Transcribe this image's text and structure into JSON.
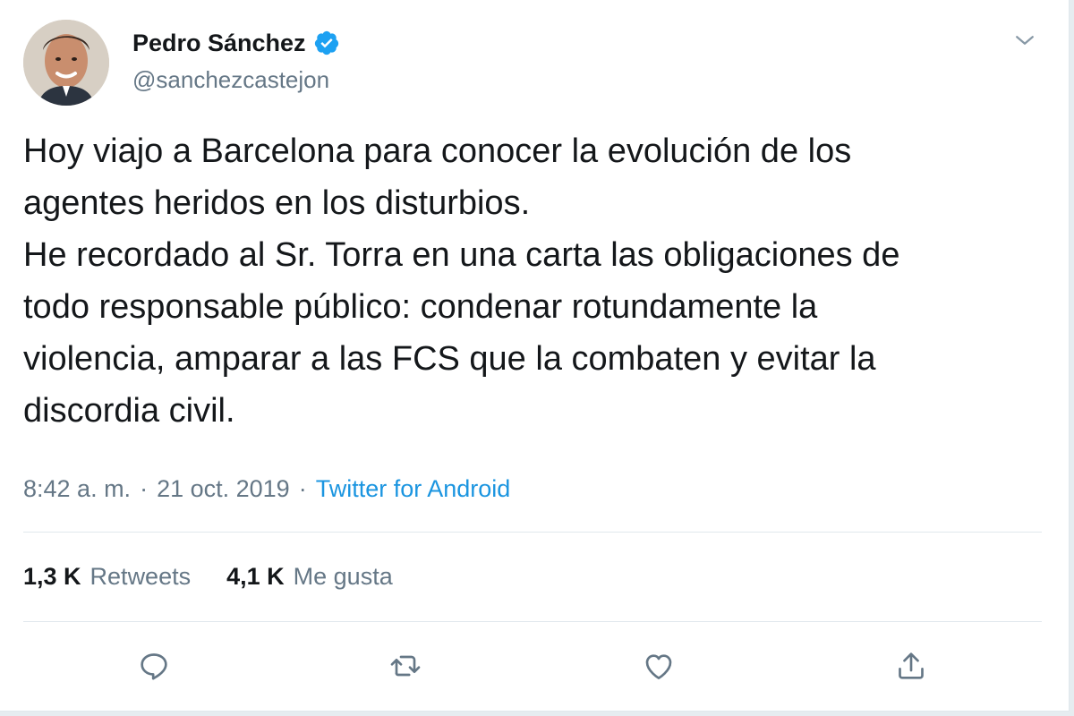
{
  "author": {
    "display_name": "Pedro Sánchez",
    "handle": "@sanchezcastejon",
    "verified": true
  },
  "tweet": {
    "text": "Hoy viajo a Barcelona para conocer la evolución de los\nagentes heridos en los disturbios.\nHe recordado al Sr. Torra en una carta las obligaciones de\ntodo responsable público: condenar rotundamente la\nviolencia, amparar a las FCS que la combaten y evitar la\ndiscordia civil."
  },
  "meta": {
    "time": "8:42 a. m.",
    "separator": "·",
    "date": "21 oct. 2019",
    "source": "Twitter for Android"
  },
  "stats": {
    "retweets_count": "1,3 K",
    "retweets_label": "Retweets",
    "likes_count": "4,1 K",
    "likes_label": "Me gusta"
  },
  "icons": {
    "verified": "verified-badge-icon",
    "menu": "chevron-down-icon",
    "reply": "reply-icon",
    "retweet": "retweet-icon",
    "like": "heart-icon",
    "share": "share-icon"
  },
  "colors": {
    "text": "#14171a",
    "secondary": "#657786",
    "link": "#1b95e0",
    "verified": "#1da1f2",
    "icon": "#657786"
  }
}
